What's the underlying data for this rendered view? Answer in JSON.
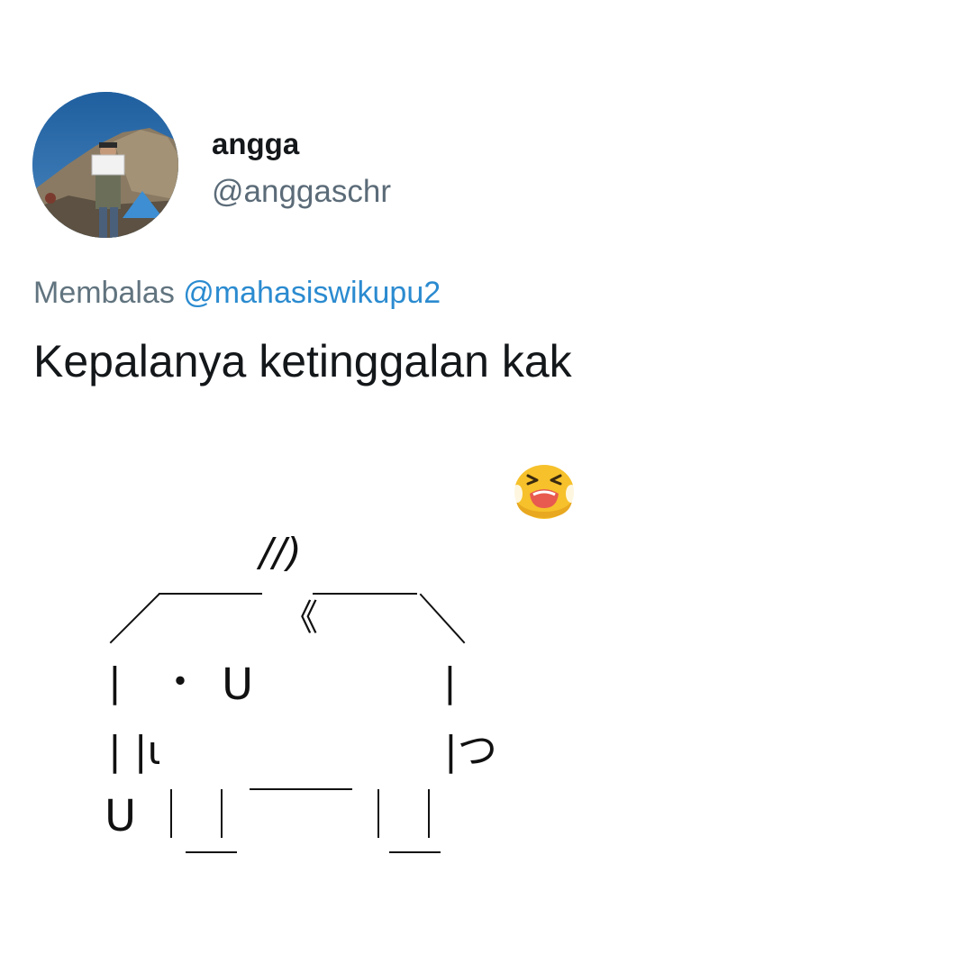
{
  "tweet": {
    "display_name": "angga",
    "handle": "@anggaschr",
    "reply_prefix": "Membalas",
    "reply_to": "@mahasiswikupu2",
    "text": "Kepalanya ketinggalan kak"
  },
  "avatar": {
    "description_icon": "profile-photo-mountain"
  },
  "emoji": {
    "icon": "loudly-crying-face-emoji"
  },
  "ascii_art": {
    "ear_marks": "//)",
    "double_bracket": "《",
    "eye_dot": "・",
    "nose_u": "U",
    "left_bar_top": "|",
    "right_bar_top": "|",
    "left_bars_mid": "| |ι",
    "right_tail": "|つ",
    "foot_u": "U"
  },
  "colors": {
    "text": "#14171a",
    "secondary": "#5b6b78",
    "mention": "#2b8bd0",
    "background": "#ffffff"
  }
}
